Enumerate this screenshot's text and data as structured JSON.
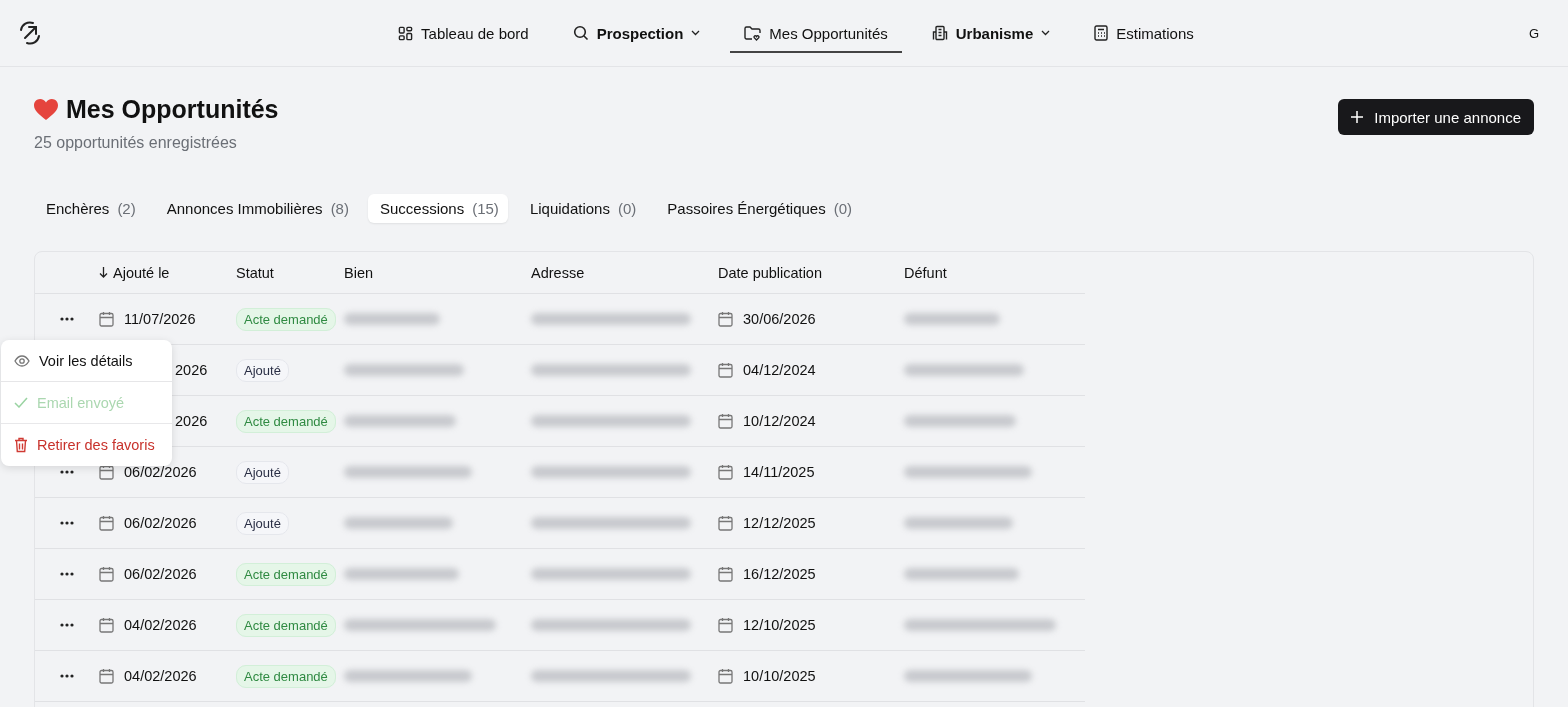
{
  "nav": {
    "avatar": "G",
    "items": [
      {
        "label": "Tableau de bord",
        "dropdown": false,
        "selected": false
      },
      {
        "label": "Prospection",
        "dropdown": true,
        "selected": false
      },
      {
        "label": "Mes Opportunités",
        "dropdown": false,
        "selected": true
      },
      {
        "label": "Urbanisme",
        "dropdown": true,
        "selected": false
      },
      {
        "label": "Estimations",
        "dropdown": false,
        "selected": false
      }
    ]
  },
  "header": {
    "title": "Mes Opportunités",
    "subtitle": "25 opportunités enregistrées",
    "import_button": "Importer une annonce"
  },
  "tabs": [
    {
      "label": "Enchères",
      "count": "(2)",
      "selected": false
    },
    {
      "label": "Annonces Immobilières",
      "count": "(8)",
      "selected": false
    },
    {
      "label": "Successions",
      "count": "(15)",
      "selected": true
    },
    {
      "label": "Liquidations",
      "count": "(0)",
      "selected": false
    },
    {
      "label": "Passoires Énergétiques",
      "count": "(0)",
      "selected": false
    }
  ],
  "table": {
    "columns": [
      "Ajouté le",
      "Statut",
      "Bien",
      "Adresse",
      "Date publication",
      "Défunt"
    ],
    "rows": [
      {
        "added": "11/07/2026",
        "covered": false,
        "status": "Acte demandé",
        "kind": "requested",
        "published": "30/06/2026"
      },
      {
        "added": "2026",
        "covered": true,
        "status": "Ajouté",
        "kind": "added",
        "published": "04/12/2024"
      },
      {
        "added": "2026",
        "covered": true,
        "status": "Acte demandé",
        "kind": "requested",
        "published": "10/12/2024"
      },
      {
        "added": "06/02/2026",
        "covered": false,
        "status": "Ajouté",
        "kind": "added",
        "published": "14/11/2025"
      },
      {
        "added": "06/02/2026",
        "covered": false,
        "status": "Ajouté",
        "kind": "added",
        "published": "12/12/2025"
      },
      {
        "added": "06/02/2026",
        "covered": false,
        "status": "Acte demandé",
        "kind": "requested",
        "published": "16/12/2025"
      },
      {
        "added": "04/02/2026",
        "covered": false,
        "status": "Acte demandé",
        "kind": "requested",
        "published": "12/10/2025"
      },
      {
        "added": "04/02/2026",
        "covered": false,
        "status": "Acte demandé",
        "kind": "requested",
        "published": "10/10/2025"
      }
    ]
  },
  "row_menu": {
    "items": [
      {
        "label": "Voir les détails",
        "kind": "view",
        "disabled": false
      },
      {
        "label": "Email envoyé",
        "kind": "done",
        "disabled": true
      },
      {
        "label": "Retirer des favoris",
        "kind": "danger",
        "disabled": false
      }
    ]
  }
}
